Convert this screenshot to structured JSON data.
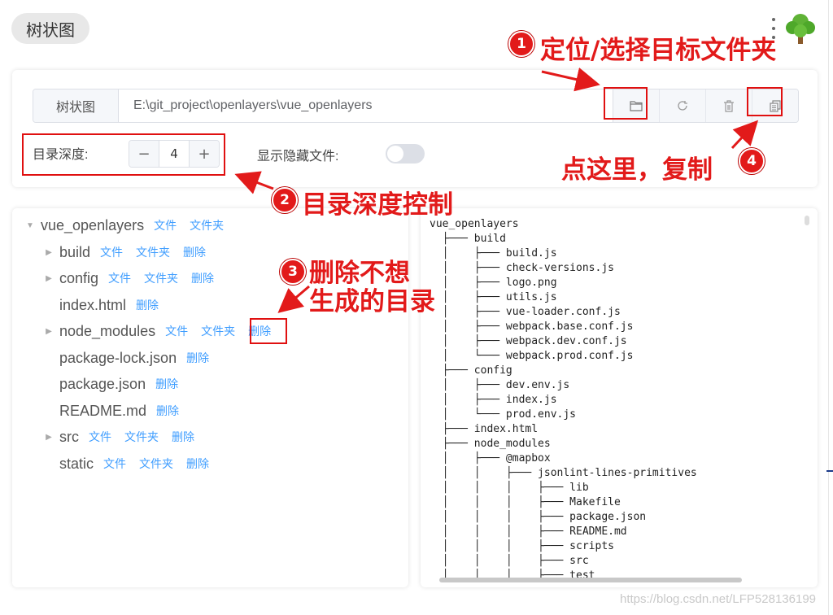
{
  "app": {
    "title": "树状图"
  },
  "icons": {
    "more": "more-vertical-icon",
    "logo": "tree-logo-icon",
    "folder": "folder-open-icon",
    "refresh": "refresh-icon",
    "delete": "trash-icon",
    "copy": "copy-icon"
  },
  "toolbar": {
    "prefix": "树状图",
    "path": "E:\\git_project\\openlayers\\vue_openlayers"
  },
  "options": {
    "depth_label": "目录深度:",
    "depth_value": "4",
    "minus": "−",
    "plus": "+",
    "show_hidden_label": "显示隐藏文件:",
    "show_hidden": false
  },
  "tree": {
    "root": {
      "label": "vue_openlayers",
      "file": "文件",
      "folder": "文件夹"
    },
    "items": [
      {
        "label": "build",
        "file": "文件",
        "folder": "文件夹",
        "delete": "删除"
      },
      {
        "label": "config",
        "file": "文件",
        "folder": "文件夹",
        "delete": "删除"
      },
      {
        "label": "index.html",
        "delete": "删除"
      },
      {
        "label": "node_modules",
        "file": "文件",
        "folder": "文件夹",
        "delete": "删除"
      },
      {
        "label": "package-lock.json",
        "delete": "删除"
      },
      {
        "label": "package.json",
        "delete": "删除"
      },
      {
        "label": "README.md",
        "delete": "删除"
      },
      {
        "label": "src",
        "file": "文件",
        "folder": "文件夹",
        "delete": "删除"
      },
      {
        "label": "static",
        "file": "文件",
        "folder": "文件夹",
        "delete": "删除"
      }
    ]
  },
  "output": {
    "lines": [
      "vue_openlayers",
      "  ├─── build",
      "  │    ├─── build.js",
      "  │    ├─── check-versions.js",
      "  │    ├─── logo.png",
      "  │    ├─── utils.js",
      "  │    ├─── vue-loader.conf.js",
      "  │    ├─── webpack.base.conf.js",
      "  │    ├─── webpack.dev.conf.js",
      "  │    └─── webpack.prod.conf.js",
      "  ├─── config",
      "  │    ├─── dev.env.js",
      "  │    ├─── index.js",
      "  │    └─── prod.env.js",
      "  ├─── index.html",
      "  ├─── node_modules",
      "  │    ├─── @mapbox",
      "  │    │    ├─── jsonlint-lines-primitives",
      "  │    │    │    ├─── lib",
      "  │    │    │    ├─── Makefile",
      "  │    │    │    ├─── package.json",
      "  │    │    │    ├─── README.md",
      "  │    │    │    ├─── scripts",
      "  │    │    │    ├─── src",
      "  │    │    │    ├─── test"
    ]
  },
  "annotations": {
    "a1": {
      "num": "1",
      "text": "定位/选择目标文件夹"
    },
    "a2": {
      "num": "2",
      "text": "目录深度控制"
    },
    "a3": {
      "num": "3",
      "text_line1": "删除不想",
      "text_line2": "生成的目录"
    },
    "a4": {
      "num": "4",
      "text": "点这里，复制"
    },
    "color": "#e21a1a"
  },
  "watermark": "https://blog.csdn.net/LFP528136199"
}
